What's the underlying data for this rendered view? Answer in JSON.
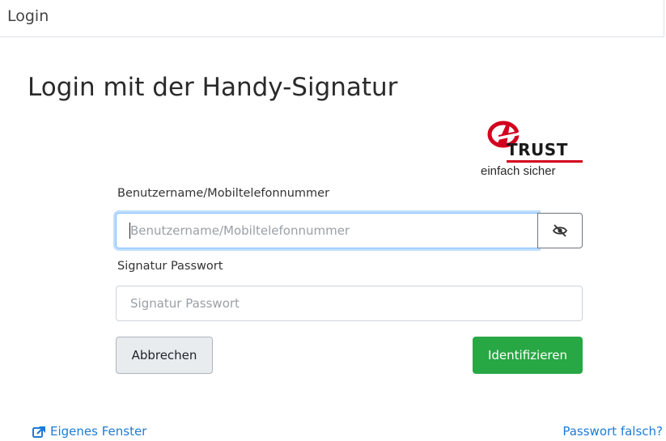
{
  "header": {
    "title": "Login"
  },
  "main": {
    "title": "Login mit der Handy-Signatur"
  },
  "brand": {
    "name": "TRUST",
    "tagline": "einfach sicher",
    "accent_color": "#d3001e"
  },
  "form": {
    "username_label": "Benutzername/Mobiltelefonnummer",
    "username_placeholder": "Benutzername/Mobiltelefonnummer",
    "username_value": "",
    "toggle_icon": "eye-slash-icon",
    "password_label": "Signatur Passwort",
    "password_placeholder": "Signatur Passwort",
    "password_value": "",
    "cancel_label": "Abbrechen",
    "submit_label": "Identifizieren",
    "submit_color": "#28a745"
  },
  "footer": {
    "own_window_icon": "external-link-icon",
    "own_window_label": "Eigenes Fenster",
    "forgot_password_label": "Passwort falsch?",
    "link_color": "#1e7bd4"
  }
}
